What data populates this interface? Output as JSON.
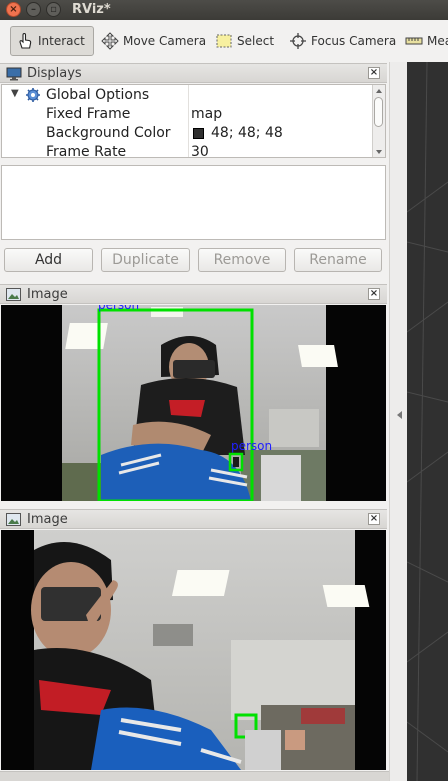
{
  "window": {
    "title": "RViz*"
  },
  "toolbar": {
    "tools": [
      {
        "label": "Interact",
        "icon": "hand-pointer-icon"
      },
      {
        "label": "Move Camera",
        "icon": "move-camera-icon"
      },
      {
        "label": "Select",
        "icon": "select-box-icon"
      },
      {
        "label": "Focus Camera",
        "icon": "focus-crosshair-icon"
      },
      {
        "label": "Mea",
        "icon": "measure-ruler-icon"
      }
    ]
  },
  "displays": {
    "title": "Displays",
    "tree": {
      "group_label": "Global Options",
      "rows": [
        {
          "key": "Fixed Frame",
          "value": "map"
        },
        {
          "key": "Background Color",
          "value": "48; 48; 48",
          "swatch": "#303030"
        },
        {
          "key": "Frame Rate",
          "value": "30"
        }
      ]
    },
    "buttons": {
      "add": "Add",
      "duplicate": "Duplicate",
      "remove": "Remove",
      "rename": "Rename"
    }
  },
  "image_panels": [
    {
      "title": "Image",
      "detections": [
        {
          "label": "person"
        },
        {
          "label": "person"
        }
      ]
    },
    {
      "title": "Image"
    }
  ],
  "colors": {
    "detection_box": "#00e000",
    "detection_label": "#2020ff",
    "viewport_background": "#303030"
  }
}
